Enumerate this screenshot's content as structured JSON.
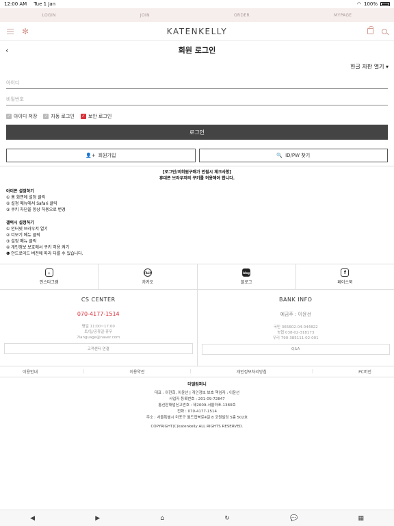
{
  "status": {
    "time": "12:00 AM",
    "date": "Tue 1 Jan",
    "battery": "100%"
  },
  "topnav": [
    "LOGIN",
    "JOIN",
    "ORDER",
    "MYPAGE"
  ],
  "header": {
    "brand": "KATENKELLY"
  },
  "page": {
    "title": "회원 로그인",
    "back": "‹"
  },
  "keyboard_toggle": "한글 자판 열기 ▾",
  "form": {
    "id_placeholder": "아이디",
    "pw_placeholder": "비밀번호",
    "checks": [
      {
        "label": "아이디 저장",
        "checked": false
      },
      {
        "label": "자동 로그인",
        "checked": false
      },
      {
        "label": "보안 로그인",
        "checked": true
      }
    ],
    "login_label": "로그인",
    "join_label": "회원가입",
    "find_label": "ID/PW 찾기"
  },
  "notice": {
    "title1": "[로그인/비회원구매가 안될시 체크사항]",
    "title2": "휴대폰 브라우저의 쿠키를 허용해야 합니다.",
    "iphone_head": "아이폰 설정하기",
    "iphone_steps": [
      "① 홈 화면에 설정 클릭",
      "② 설정 메뉴에서 Safari 클릭",
      "③ 쿠키 차단을 항상 허용으로 변경"
    ],
    "galaxy_head": "갤럭시 설정하기",
    "galaxy_steps": [
      "① 인터넷 브라우저 열기",
      "② 더보기 메뉴 클릭",
      "③ 설정 메뉴 클릭",
      "④ 개인정보 보호에서 쿠키 허용 켜기",
      "❶ 안드로이드 버전에 따라 다를 수 있습니다."
    ]
  },
  "social": [
    {
      "label": "인스타그램",
      "icon": "instagram-icon"
    },
    {
      "label": "카카오",
      "icon": "kakao-talk-icon",
      "glyph": "TALK"
    },
    {
      "label": "블로그",
      "icon": "blog-icon",
      "glyph": "blog"
    },
    {
      "label": "페이스북",
      "icon": "facebook-icon",
      "glyph": "f"
    }
  ],
  "cs": {
    "title": "CS CENTER",
    "phone": "070-4177-1514",
    "hours": "평일 11:00~17:00",
    "holiday": "토/일/공휴일-휴무",
    "email": "7language@naver.com",
    "button": "고객센터 연결"
  },
  "bank": {
    "title": "BANK INFO",
    "owner": "예금주 : 이윤선",
    "accounts": [
      "국민 365602-04-044822",
      "농협 038-02-318173",
      "우리 790-385111-02-001"
    ],
    "button": "Q&A"
  },
  "links": [
    "이용안내",
    "이용약관",
    "개인정보처리방침",
    "PC버전"
  ],
  "company": {
    "name": "더엘컴퍼니",
    "lines": [
      "대표 : 이현희, 이윤선  |  개인정보 보호 책임자 : 이윤선",
      "사업자 등록번호 : 201-09-72847",
      "통신판매업신고번호 : 제2009-서울마포-1380호",
      "전화 : 070-4177-1514",
      "주소 : 서울특별시 마포구 월드컵북로4길 8 코원빌딩 5층 502호"
    ],
    "copyright": "COPYRIGHT(C)katenkelly ALL RIGHTS RESERVED."
  },
  "bottombar": [
    "◀",
    "▶",
    "⌂",
    "↻",
    "💬",
    "▦"
  ]
}
